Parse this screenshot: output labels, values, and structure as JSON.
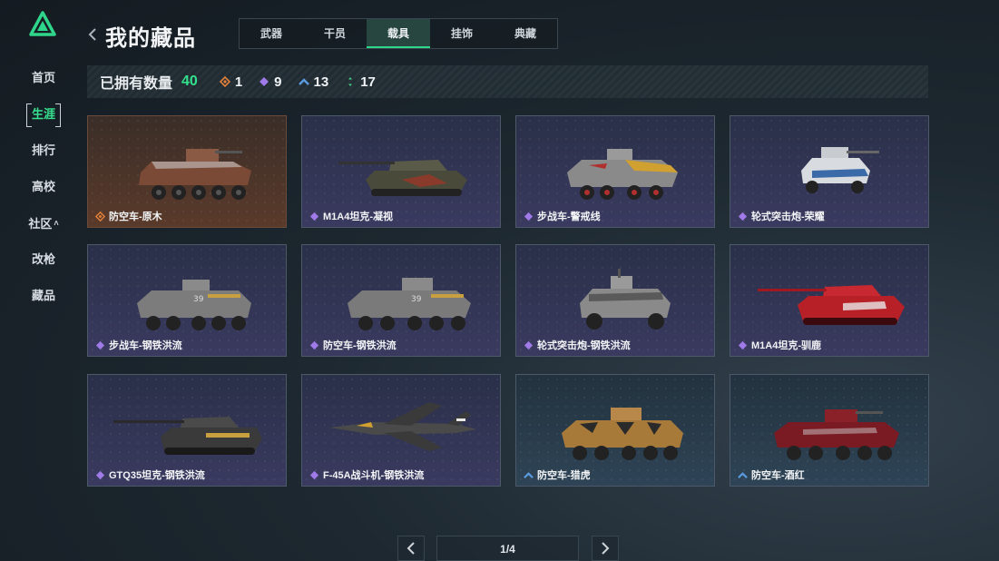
{
  "nav": {
    "items": [
      {
        "label": "首页"
      },
      {
        "label": "生涯"
      },
      {
        "label": "排行"
      },
      {
        "label": "高校"
      },
      {
        "label": "社区"
      },
      {
        "label": "改枪"
      },
      {
        "label": "藏品"
      }
    ],
    "active_index": 1
  },
  "header": {
    "title": "我的藏品",
    "tabs": [
      {
        "label": "武器"
      },
      {
        "label": "干员"
      },
      {
        "label": "载具"
      },
      {
        "label": "挂饰"
      },
      {
        "label": "典藏"
      }
    ],
    "active_tab_index": 2
  },
  "stats": {
    "owned_label": "已拥有数量",
    "owned_count": "40",
    "rarity_counts": [
      {
        "icon": "orange-diamond-icon",
        "color": "#e0803a",
        "count": "1"
      },
      {
        "icon": "purple-diamond-icon",
        "color": "#a07ae8",
        "count": "9"
      },
      {
        "icon": "blue-chevron-icon",
        "color": "#5a9be0",
        "count": "13"
      },
      {
        "icon": "green-dots-icon",
        "color": "#3fd08a",
        "count": "17"
      }
    ]
  },
  "items": [
    {
      "name": "防空车-原木",
      "rarity": "orange"
    },
    {
      "name": "M1A4坦克-凝视",
      "rarity": "purple"
    },
    {
      "name": "步战车-警戒线",
      "rarity": "purple"
    },
    {
      "name": "轮式突击炮-荣耀",
      "rarity": "purple"
    },
    {
      "name": "步战车-钢铁洪流",
      "rarity": "purple"
    },
    {
      "name": "防空车-钢铁洪流",
      "rarity": "purple"
    },
    {
      "name": "轮式突击炮-钢铁洪流",
      "rarity": "purple"
    },
    {
      "name": "M1A4坦克-驯鹿",
      "rarity": "purple"
    },
    {
      "name": "GTQ35坦克-钢铁洪流",
      "rarity": "purple"
    },
    {
      "name": "F-45A战斗机-钢铁洪流",
      "rarity": "purple"
    },
    {
      "name": "防空车-猎虎",
      "rarity": "blue"
    },
    {
      "name": "防空车-酒红",
      "rarity": "blue"
    }
  ],
  "pagination": {
    "text": "1/4"
  },
  "colors": {
    "accent": "#36e08f",
    "orange": "#e0803a",
    "purple": "#a07ae8",
    "blue": "#5a9be0"
  }
}
